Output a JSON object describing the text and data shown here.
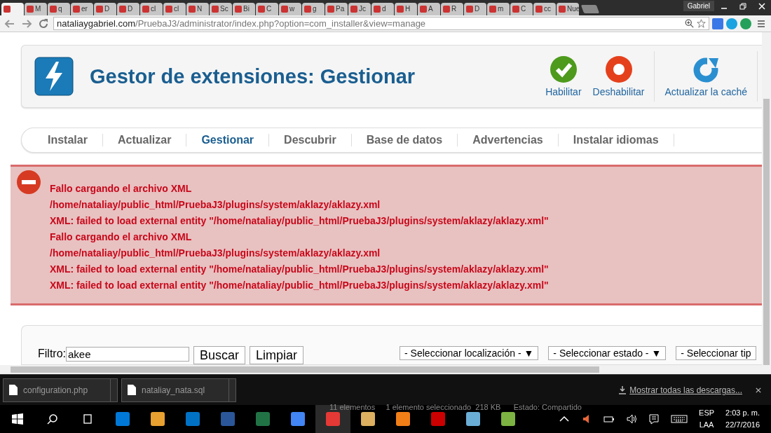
{
  "browser": {
    "tabs": [
      {
        "selected": true
      },
      {
        "label": "M",
        "selected": false
      },
      {
        "label": "q",
        "selected": false
      },
      {
        "label": "er",
        "selected": false
      },
      {
        "label": "D",
        "selected": false
      },
      {
        "label": "D",
        "selected": false
      },
      {
        "label": "cl",
        "selected": false
      },
      {
        "label": "cl",
        "selected": false
      },
      {
        "label": "N",
        "selected": false
      },
      {
        "label": "Sc",
        "selected": false
      },
      {
        "label": "Bi",
        "selected": false
      },
      {
        "label": "C",
        "selected": false
      },
      {
        "label": "w",
        "selected": false
      },
      {
        "label": "g",
        "selected": false
      },
      {
        "label": "Pa",
        "selected": false
      },
      {
        "label": "Jc",
        "selected": false
      },
      {
        "label": "d",
        "selected": false
      },
      {
        "label": "H",
        "selected": false
      },
      {
        "label": "A",
        "selected": false
      },
      {
        "label": "R",
        "selected": false
      },
      {
        "label": "D",
        "selected": false
      },
      {
        "label": "m",
        "selected": false
      },
      {
        "label": "C",
        "selected": false
      },
      {
        "label": "cc",
        "selected": false
      },
      {
        "label": "Nue",
        "selected": false
      }
    ],
    "profile": "Gabriel",
    "url_host": "nataliaygabriel.com",
    "url_path": "/PruebaJ3/administrator/index.php?option=com_installer&view=manage"
  },
  "page": {
    "title": "Gestor de extensiones: Gestionar",
    "toolbar": [
      {
        "kind": "enable",
        "label": "Habilitar"
      },
      {
        "kind": "disable",
        "label": "Deshabilitar"
      },
      {
        "kind": "refresh",
        "label": "Actualizar la caché"
      }
    ],
    "tabs": [
      {
        "label": "Instalar",
        "selected": false
      },
      {
        "label": "Actualizar",
        "selected": false
      },
      {
        "label": "Gestionar",
        "selected": true
      },
      {
        "label": "Descubrir",
        "selected": false
      },
      {
        "label": "Base de datos",
        "selected": false
      },
      {
        "label": "Advertencias",
        "selected": false
      },
      {
        "label": "Instalar idiomas",
        "selected": false
      }
    ],
    "errors": [
      "Fallo cargando el archivo XML",
      "/home/nataliay/public_html/PruebaJ3/plugins/system/aklazy/aklazy.xml",
      "XML: failed to load external entity \"/home/nataliay/public_html/PruebaJ3/plugins/system/aklazy/aklazy.xml\"",
      "Fallo cargando el archivo XML",
      "/home/nataliay/public_html/PruebaJ3/plugins/system/aklazy/aklazy.xml",
      "XML: failed to load external entity \"/home/nataliay/public_html/PruebaJ3/plugins/system/aklazy/aklazy.xml\"",
      "XML: failed to load external entity \"/home/nataliay/public_html/PruebaJ3/plugins/system/aklazy/aklazy.xml\""
    ],
    "filter": {
      "label": "Filtro:",
      "value": "akee",
      "search_button": "Buscar",
      "clear_button": "Limpiar",
      "selects": [
        "- Seleccionar localización - ▼",
        "- Seleccionar estado - ▼",
        "- Seleccionar tip"
      ]
    }
  },
  "downloads": {
    "items": [
      "configuration.php",
      "nataliay_nata.sql"
    ],
    "show_all": "Mostrar todas las descargas..."
  },
  "taskbar": {
    "behind_text": "11 elementos     1 elemento seleccionado  218 KB      Estado: Compartido",
    "lang_top": "ESP",
    "lang_bottom": "LAA",
    "time": "2:03 p. m.",
    "date": "22/7/2016"
  }
}
